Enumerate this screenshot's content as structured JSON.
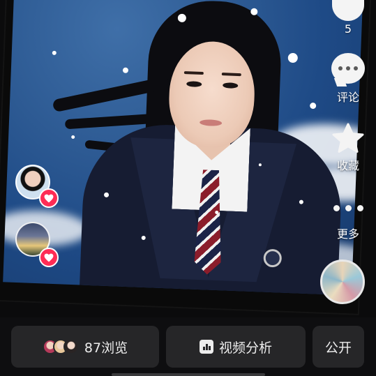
{
  "rail": {
    "like_count": "5",
    "comment_label": "评论",
    "favorite_label": "收藏",
    "more_label": "更多"
  },
  "bottom": {
    "views_label": "87浏览",
    "analysis_label": "视频分析",
    "privacy_label": "公开"
  },
  "colors": {
    "like_badge": "#fe2c55",
    "pill_bg": "#262628",
    "background": "#0e0e10"
  },
  "icons": [
    "heart-icon",
    "comment-icon",
    "star-icon",
    "more-icon",
    "chart-icon"
  ]
}
